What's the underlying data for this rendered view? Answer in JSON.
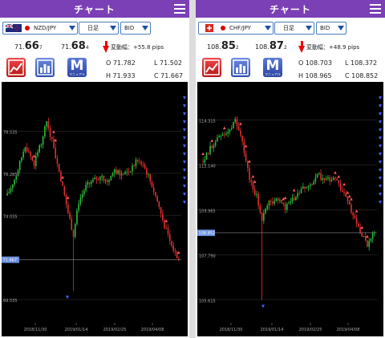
{
  "panels": [
    {
      "title": "チャート",
      "pair": "NZD/JPY",
      "flag": "nz",
      "period": "日足",
      "price_type": "BID",
      "bid": {
        "head": "71.",
        "big": "66",
        "tail": "7"
      },
      "ask": {
        "head": "71.",
        "big": "68",
        "tail": "4"
      },
      "change_text": "変動幅：+55.8 pips",
      "ohlc": {
        "O": "O 71.782",
        "L": "L 71.502",
        "H": "H 71.933",
        "C": "C 71.667"
      },
      "manual_label": "マニュアル",
      "y_ticks": [
        {
          "value": 78.535,
          "label": "78.535"
        },
        {
          "value": 76.285,
          "label": "76.285"
        },
        {
          "value": 74.035,
          "label": "74.035"
        },
        {
          "value": 69.535,
          "label": "69.535"
        }
      ],
      "current_price": {
        "value": 71.667,
        "label": "71.667"
      },
      "x_ticks": [
        "2018/11/30",
        "2019/01/14",
        "2019/02/25",
        "2019/04/08"
      ],
      "yrange": [
        68.3,
        81.0
      ],
      "series": {
        "start": 75.1,
        "waypoints": [
          [
            0,
            75.1
          ],
          [
            5,
            76.2
          ],
          [
            10,
            77.8
          ],
          [
            15,
            76.8
          ],
          [
            20,
            78.2
          ],
          [
            22,
            79.1
          ],
          [
            26,
            77.6
          ],
          [
            30,
            76.0
          ],
          [
            34,
            74.2
          ],
          [
            37,
            73.0
          ],
          [
            40,
            74.8
          ],
          [
            44,
            75.6
          ],
          [
            48,
            75.9
          ],
          [
            52,
            76.1
          ],
          [
            56,
            75.8
          ],
          [
            60,
            76.5
          ],
          [
            64,
            76.2
          ],
          [
            68,
            76.4
          ],
          [
            72,
            76.9
          ],
          [
            76,
            76.8
          ],
          [
            80,
            75.9
          ],
          [
            84,
            74.8
          ],
          [
            88,
            73.5
          ],
          [
            92,
            72.4
          ],
          [
            96,
            71.7
          ]
        ],
        "spike_day": 37,
        "spike_low": 70.0
      }
    },
    {
      "title": "チャート",
      "pair": "CHF/JPY",
      "flag": "ch",
      "period": "日足",
      "price_type": "BID",
      "bid": {
        "head": "108.",
        "big": "85",
        "tail": "2"
      },
      "ask": {
        "head": "108.",
        "big": "87",
        "tail": "2"
      },
      "change_text": "変動幅：+48.9 pips",
      "ohlc": {
        "O": "O 108.703",
        "L": "L 108.372",
        "H": "H 108.965",
        "C": "C 108.852"
      },
      "manual_label": "マニュアル",
      "y_ticks": [
        {
          "value": 114.315,
          "label": "114.315"
        },
        {
          "value": 112.14,
          "label": "112.140"
        },
        {
          "value": 109.965,
          "label": "109.965"
        },
        {
          "value": 107.79,
          "label": "107.790"
        },
        {
          "value": 105.615,
          "label": "105.615"
        }
      ],
      "current_price": {
        "value": 108.852,
        "label": "108.852"
      },
      "x_ticks": [
        "2018/11/30",
        "2019/01/14",
        "2019/02/25",
        "2019/04/08"
      ],
      "yrange": [
        104.5,
        116.0
      ],
      "series": {
        "start": 112.3,
        "waypoints": [
          [
            0,
            112.3
          ],
          [
            5,
            113.1
          ],
          [
            10,
            113.6
          ],
          [
            15,
            113.9
          ],
          [
            18,
            114.3
          ],
          [
            22,
            113.2
          ],
          [
            26,
            111.5
          ],
          [
            30,
            110.6
          ],
          [
            33,
            109.5
          ],
          [
            37,
            110.3
          ],
          [
            42,
            110.5
          ],
          [
            46,
            110.1
          ],
          [
            50,
            110.4
          ],
          [
            55,
            110.9
          ],
          [
            60,
            111.2
          ],
          [
            64,
            111.7
          ],
          [
            68,
            111.4
          ],
          [
            72,
            111.5
          ],
          [
            76,
            111.2
          ],
          [
            80,
            110.6
          ],
          [
            84,
            109.7
          ],
          [
            88,
            108.9
          ],
          [
            92,
            108.3
          ],
          [
            96,
            108.85
          ]
        ],
        "spike_day": 33,
        "spike_low": 105.6
      }
    }
  ]
}
